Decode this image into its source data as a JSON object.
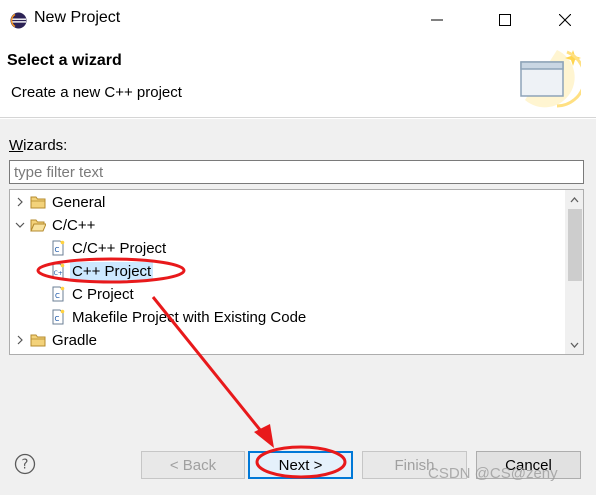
{
  "window": {
    "title": "New Project"
  },
  "header": {
    "title": "Select a wizard",
    "description": "Create a new C++ project"
  },
  "wizards": {
    "label_prefix": "W",
    "label_rest": "izards:",
    "filter_placeholder": "type filter text",
    "tree": [
      {
        "label": "General",
        "expanded": false,
        "kind": "folder"
      },
      {
        "label": "C/C++",
        "expanded": true,
        "kind": "folder"
      },
      {
        "label": "C/C++ Project",
        "kind": "project"
      },
      {
        "label": "C++ Project",
        "kind": "project",
        "selected": true
      },
      {
        "label": "C Project",
        "kind": "project"
      },
      {
        "label": "Makefile Project with Existing Code",
        "kind": "project"
      },
      {
        "label": "Gradle",
        "expanded": false,
        "kind": "folder"
      }
    ]
  },
  "buttons": {
    "back": "< Back",
    "next": "Next >",
    "finish": "Finish",
    "cancel": "Cancel"
  },
  "watermark": "CSDN @CS@zeny",
  "colors": {
    "selection": "#cce8ff",
    "annotation_red": "#e8191b",
    "default_button_border": "#0078d7"
  }
}
